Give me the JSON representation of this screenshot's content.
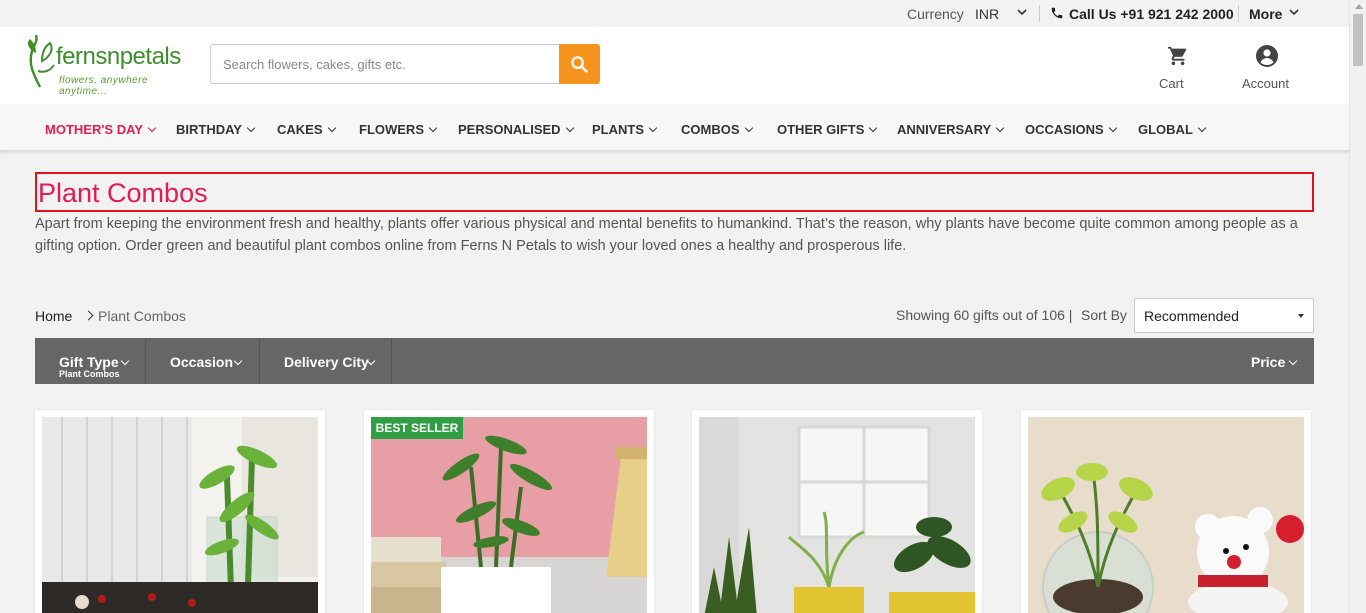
{
  "topbar": {
    "currency_label": "Currency",
    "currency_value": "INR",
    "call_text": "Call Us +91 921 242 2000",
    "more_label": "More"
  },
  "header": {
    "logo_text": "fernsnpetals",
    "logo_tagline": "flowers, anywhere anytime...",
    "search_placeholder": "Search flowers, cakes, gifts etc.",
    "cart_label": "Cart",
    "account_label": "Account",
    "accent_color": "#f7941d"
  },
  "nav": {
    "items": [
      {
        "label": "MOTHER'S DAY"
      },
      {
        "label": "BIRTHDAY"
      },
      {
        "label": "CAKES"
      },
      {
        "label": "FLOWERS"
      },
      {
        "label": "PERSONALISED"
      },
      {
        "label": "PLANTS"
      },
      {
        "label": "COMBOS"
      },
      {
        "label": "OTHER GIFTS"
      },
      {
        "label": "ANNIVERSARY"
      },
      {
        "label": "OCCASIONS"
      },
      {
        "label": "GLOBAL"
      }
    ],
    "active_color": "#e21c52"
  },
  "page": {
    "title": "Plant Combos",
    "description": "Apart from keeping the environment fresh and healthy, plants offer various physical and mental benefits to humankind. That’s the reason, why plants have become quite common among people as a gifting option. Order green and beautiful plant combos online from Ferns N Petals to wish your loved ones a healthy and prosperous life."
  },
  "breadcrumb": {
    "home": "Home",
    "current": "Plant Combos"
  },
  "results": {
    "showing_text": "Showing 60 gifts out of 106 |",
    "sort_label": "Sort By",
    "sort_value": "Recommended"
  },
  "filters": {
    "gift_type_label": "Gift Type",
    "gift_type_value": "Plant Combos",
    "occasion_label": "Occasion",
    "delivery_city_label": "Delivery City",
    "price_label": "Price"
  },
  "products": [
    {
      "badge": ""
    },
    {
      "badge": "BEST SELLER"
    },
    {
      "badge": ""
    },
    {
      "badge": ""
    }
  ]
}
